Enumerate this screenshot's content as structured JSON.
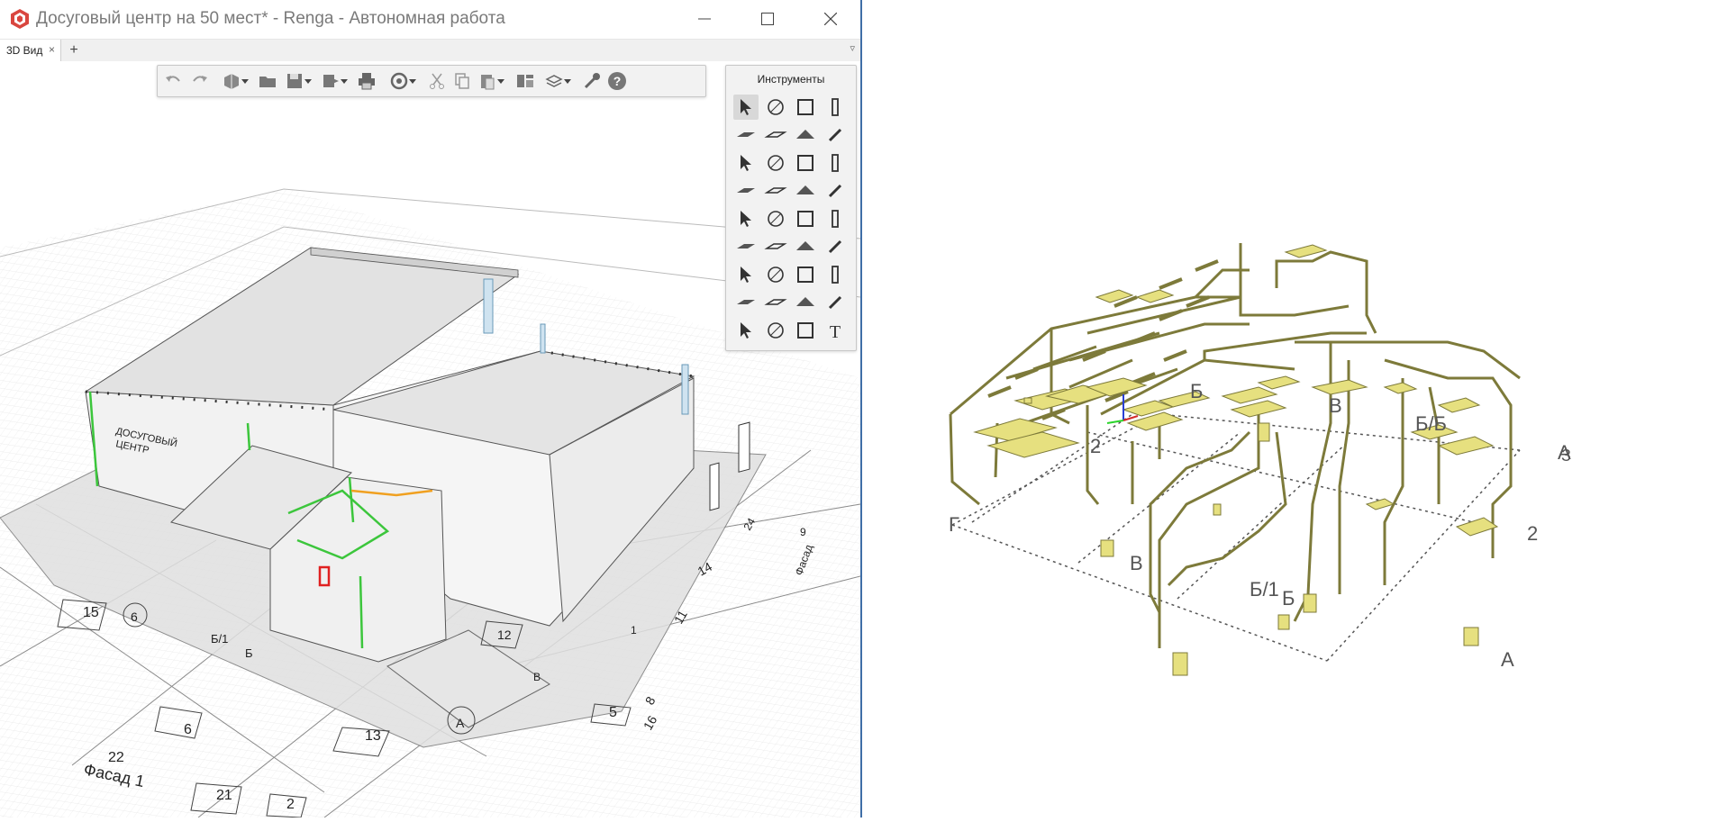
{
  "window": {
    "title": "Досуговый центр на 50 мест* - Renga - Автономная работа",
    "minimize_glyph": "—",
    "maximize_glyph": "☐",
    "close_glyph": "✕"
  },
  "tabs": {
    "items": [
      {
        "label": "3D Вид"
      }
    ],
    "close_glyph": "×",
    "add_glyph": "+",
    "menu_glyph": "▿"
  },
  "toolbar": {
    "icons": [
      "undo-icon",
      "redo-icon",
      "new-project-icon",
      "dropdown-icon",
      "open-icon",
      "save-icon",
      "dropdown-icon",
      "export-icon",
      "dropdown-icon",
      "print-icon",
      "sync-icon",
      "dropdown-icon",
      "cut-icon",
      "copy-icon",
      "paste-icon",
      "dropdown-icon",
      "properties-icon",
      "views-icon",
      "dropdown-icon",
      "settings-icon",
      "help-icon"
    ]
  },
  "tools": {
    "title": "Инструменты",
    "grid": [
      [
        "select-icon",
        "axis-icon",
        "wall-view-icon",
        "column-icon"
      ],
      [
        "slab-icon",
        "opening-icon",
        "roof-icon",
        "beam-icon"
      ],
      [
        "stair-icon",
        "ramp-icon",
        "door-icon",
        "window-icon"
      ],
      [
        "railing-icon",
        "line-icon",
        "equipment-icon",
        "pipe-icon"
      ],
      [
        "sanitary-icon",
        "boiler-icon",
        "fan-icon",
        "duct-fitting-icon"
      ],
      [
        "valve-icon",
        "device-icon",
        "pump-icon",
        "accessory-icon"
      ],
      [
        "fire-icon",
        "light-icon",
        "electric-icon",
        "outlet-icon"
      ],
      [
        "panel-icon",
        "element-icon",
        "hatch-icon",
        "room-icon"
      ],
      [
        "dimension-icon",
        "route-icon",
        "material-icon",
        "text-icon"
      ]
    ]
  },
  "left_scene": {
    "sign_text": [
      "ДОСУГОВЫЙ",
      "ЦЕНТР"
    ],
    "labels": [
      {
        "t": "15"
      },
      {
        "t": "6"
      },
      {
        "t": "6"
      },
      {
        "t": "21"
      },
      {
        "t": "2"
      },
      {
        "t": "22"
      },
      {
        "t": "Фасад 1"
      },
      {
        "t": "13"
      },
      {
        "t": "A"
      },
      {
        "t": "5"
      },
      {
        "t": "16"
      },
      {
        "t": "8"
      },
      {
        "t": "12"
      },
      {
        "t": "11"
      },
      {
        "t": "14"
      },
      {
        "t": "9"
      },
      {
        "t": "24"
      },
      {
        "t": "Фасад"
      },
      {
        "t": "Б/1"
      },
      {
        "t": "Б"
      },
      {
        "t": "1"
      },
      {
        "t": "В"
      }
    ]
  },
  "right_scene": {
    "axis_labels": [
      "Г",
      "В",
      "Б/1",
      "Б",
      "2",
      "А",
      "А",
      "2",
      "Б",
      "В",
      "Б/Б",
      "З"
    ]
  },
  "colors": {
    "window_border": "#3f6ea7",
    "pipe_color": "#7d7a3a",
    "equipment_color": "#e6e07f",
    "pipe_green": "#3cc63c",
    "pipe_orange": "#f0a020",
    "pipe_red": "#e02020"
  }
}
